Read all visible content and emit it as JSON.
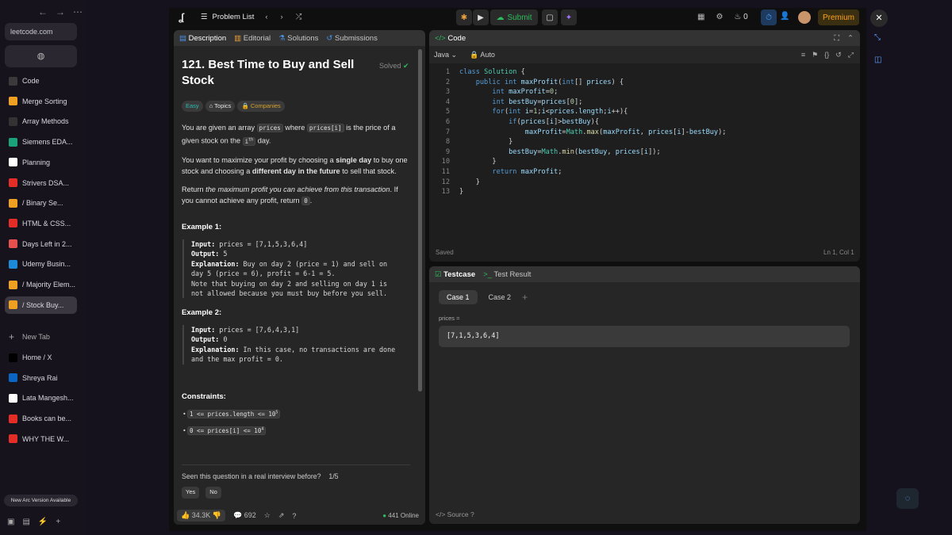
{
  "browser": {
    "url": "leetcode.com",
    "sidebar_items": [
      {
        "label": "Code",
        "icon": "code-favicon",
        "color": "#3a3a3a"
      },
      {
        "label": "Merge Sorting",
        "icon": "merge-favicon",
        "color": "#f0a020"
      },
      {
        "label": "Array Methods",
        "icon": "m-favicon",
        "color": "#333"
      },
      {
        "label": "Siemens EDA...",
        "icon": "siemens-favicon",
        "color": "#1aa37a"
      },
      {
        "label": "Planning",
        "icon": "notion-favicon",
        "color": "#fff"
      },
      {
        "label": "Strivers DSA...",
        "icon": "youtube-favicon",
        "color": "#e52d27"
      },
      {
        "label": "/ Binary Se...",
        "icon": "leetcode-favicon",
        "color": "#f0a020"
      },
      {
        "label": "HTML & CSS...",
        "icon": "youtube-favicon",
        "color": "#e52d27"
      },
      {
        "label": "Days Left in 2...",
        "icon": "calendar-favicon",
        "color": "#e85050"
      },
      {
        "label": "Udemy Busin...",
        "icon": "udemy-favicon",
        "color": "#1c8ad6"
      },
      {
        "label": "/ Majority Elem...",
        "icon": "leetcode-favicon",
        "color": "#f0a020"
      },
      {
        "label": "/ Stock Buy...",
        "icon": "leetcode-favicon",
        "color": "#f0a020"
      }
    ],
    "new_tab": "New Tab",
    "tabs2": [
      {
        "label": "Home / X",
        "icon": "x-favicon",
        "color": "#000"
      },
      {
        "label": "Shreya Rai",
        "icon": "linkedin-favicon",
        "color": "#0a66c2"
      },
      {
        "label": "Lata Mangesh...",
        "icon": "wikipedia-favicon",
        "color": "#fff"
      },
      {
        "label": "Books can be...",
        "icon": "youtube-favicon",
        "color": "#e52d27"
      },
      {
        "label": "WHY THE W...",
        "icon": "youtube-favicon",
        "color": "#e52d27"
      }
    ],
    "update_banner": "New Arc Version Available"
  },
  "topbar": {
    "problem_list": "Problem List",
    "submit": "Submit",
    "streak_count": "0",
    "premium": "Premium"
  },
  "description": {
    "tabs": [
      "Description",
      "Editorial",
      "Solutions",
      "Submissions"
    ],
    "title": "121. Best Time to Buy and Sell Stock",
    "status": "Solved",
    "difficulty": "Easy",
    "topics": "Topics",
    "companies": "Companies",
    "p1_a": "You are given an array",
    "p1_code1": "prices",
    "p1_b": "where",
    "p1_code2": "prices[i]",
    "p1_c": "is the price of a given stock on the",
    "p1_sup": "i",
    "p1_supth": "th",
    "p1_d": "day.",
    "p2_a": "You want to maximize your profit by choosing a",
    "p2_b1": "single day",
    "p2_b": "to buy one stock and choosing a",
    "p2_b2": "different day in the future",
    "p2_c": "to sell that stock.",
    "p3_a": "Return",
    "p3_i": "the maximum profit you can achieve from this transaction",
    "p3_b": ". If you cannot achieve any profit, return",
    "p3_code": "0",
    "example1_title": "Example 1:",
    "example1_lines": [
      {
        "k": "Input:",
        "v": " prices = [7,1,5,3,6,4]"
      },
      {
        "k": "Output:",
        "v": " 5"
      },
      {
        "k": "Explanation:",
        "v": " Buy on day 2 (price = 1) and sell on"
      },
      {
        "k": "",
        "v": "day 5 (price = 6), profit = 6-1 = 5."
      },
      {
        "k": "",
        "v": "Note that buying on day 2 and selling on day 1 is"
      },
      {
        "k": "",
        "v": "not allowed because you must buy before you sell."
      }
    ],
    "example2_title": "Example 2:",
    "example2_lines": [
      {
        "k": "Input:",
        "v": " prices = [7,6,4,3,1]"
      },
      {
        "k": "Output:",
        "v": " 0"
      },
      {
        "k": "Explanation:",
        "v": " In this case, no transactions are done"
      },
      {
        "k": "",
        "v": "and the max profit = 0."
      }
    ],
    "constraints_title": "Constraints:",
    "constraint1": "1 <= prices.length <= 10",
    "constraint1_sup": "5",
    "constraint2": "0 <= prices[i] <= 10",
    "constraint2_sup": "4",
    "interview_q": "Seen this question in a real interview before?",
    "interview_count": "1/5",
    "yes": "Yes",
    "no": "No",
    "likes": "34.3K",
    "comments": "692",
    "online": "441 Online"
  },
  "editor": {
    "title": "Code",
    "language": "Java",
    "mode": "Auto",
    "status": "Saved",
    "cursor": "Ln 1, Col 1",
    "lines": [
      "class Solution {",
      "    public int maxProfit(int[] prices) {",
      "        int maxProfit=0;",
      "        int bestBuy=prices[0];",
      "        for(int i=1;i<prices.length;i++){",
      "            if(prices[i]>bestBuy){",
      "                maxProfit=Math.max(maxProfit, prices[i]-bestBuy);",
      "            }",
      "            bestBuy=Math.min(bestBuy, prices[i]);",
      "        }",
      "        return maxProfit;",
      "    }",
      "}"
    ]
  },
  "testcase": {
    "tab1": "Testcase",
    "tab2": "Test Result",
    "case1": "Case 1",
    "case2": "Case 2",
    "param_label": "prices =",
    "param_value": "[7,1,5,3,6,4]",
    "source": "Source"
  }
}
